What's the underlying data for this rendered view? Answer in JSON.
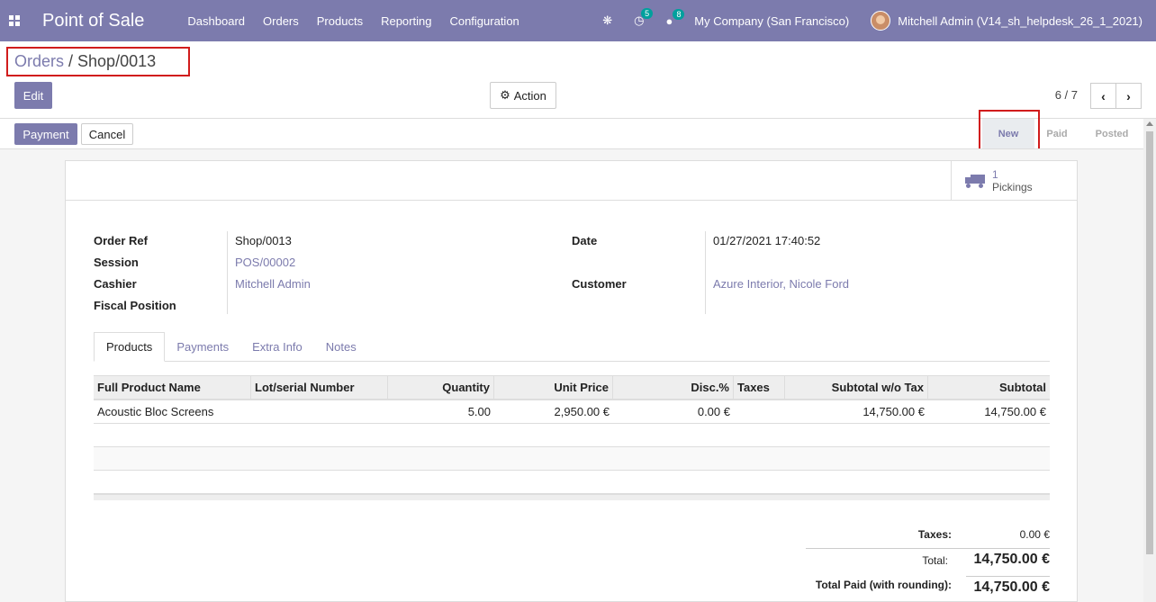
{
  "navbar": {
    "app_title": "Point of Sale",
    "menu": [
      "Dashboard",
      "Orders",
      "Products",
      "Reporting",
      "Configuration"
    ],
    "activity_count": "5",
    "message_count": "8",
    "company": "My Company (San Francisco)",
    "user": "Mitchell Admin (V14_sh_helpdesk_26_1_2021)"
  },
  "breadcrumb": {
    "parent": "Orders",
    "separator": " / ",
    "current": "Shop/0013"
  },
  "control": {
    "edit_label": "Edit",
    "action_label": "Action",
    "pager": "6 / 7",
    "prev_icon": "‹",
    "next_icon": "›"
  },
  "statusbar": {
    "payment_label": "Payment",
    "cancel_label": "Cancel",
    "stages": [
      "New",
      "Paid",
      "Posted"
    ],
    "active_stage": "New"
  },
  "smart_button": {
    "count": "1",
    "label": "Pickings"
  },
  "fields": {
    "order_ref_label": "Order Ref",
    "order_ref": "Shop/0013",
    "session_label": "Session",
    "session": "POS/00002",
    "cashier_label": "Cashier",
    "cashier": "Mitchell Admin",
    "fiscal_position_label": "Fiscal Position",
    "date_label": "Date",
    "date": "01/27/2021 17:40:52",
    "customer_label": "Customer",
    "customer": "Azure Interior, Nicole Ford"
  },
  "tabs": [
    "Products",
    "Payments",
    "Extra Info",
    "Notes"
  ],
  "table": {
    "headers": [
      "Full Product Name",
      "Lot/serial Number",
      "Quantity",
      "Unit Price",
      "Disc.%",
      "Taxes",
      "Subtotal w/o Tax",
      "Subtotal"
    ],
    "rows": [
      [
        "Acoustic Bloc Screens",
        "",
        "5.00",
        "2,950.00 €",
        "0.00 €",
        "",
        "14,750.00 €",
        "14,750.00 €"
      ]
    ]
  },
  "totals": {
    "taxes_label": "Taxes:",
    "taxes": "0.00 €",
    "total_label": "Total:",
    "total": "14,750.00 €",
    "paid_label": "Total Paid (with rounding):",
    "paid": "14,750.00 €"
  },
  "colors": {
    "brand": "#7c7bad",
    "highlight": "#d11c1c",
    "badge": "#00a09d"
  }
}
